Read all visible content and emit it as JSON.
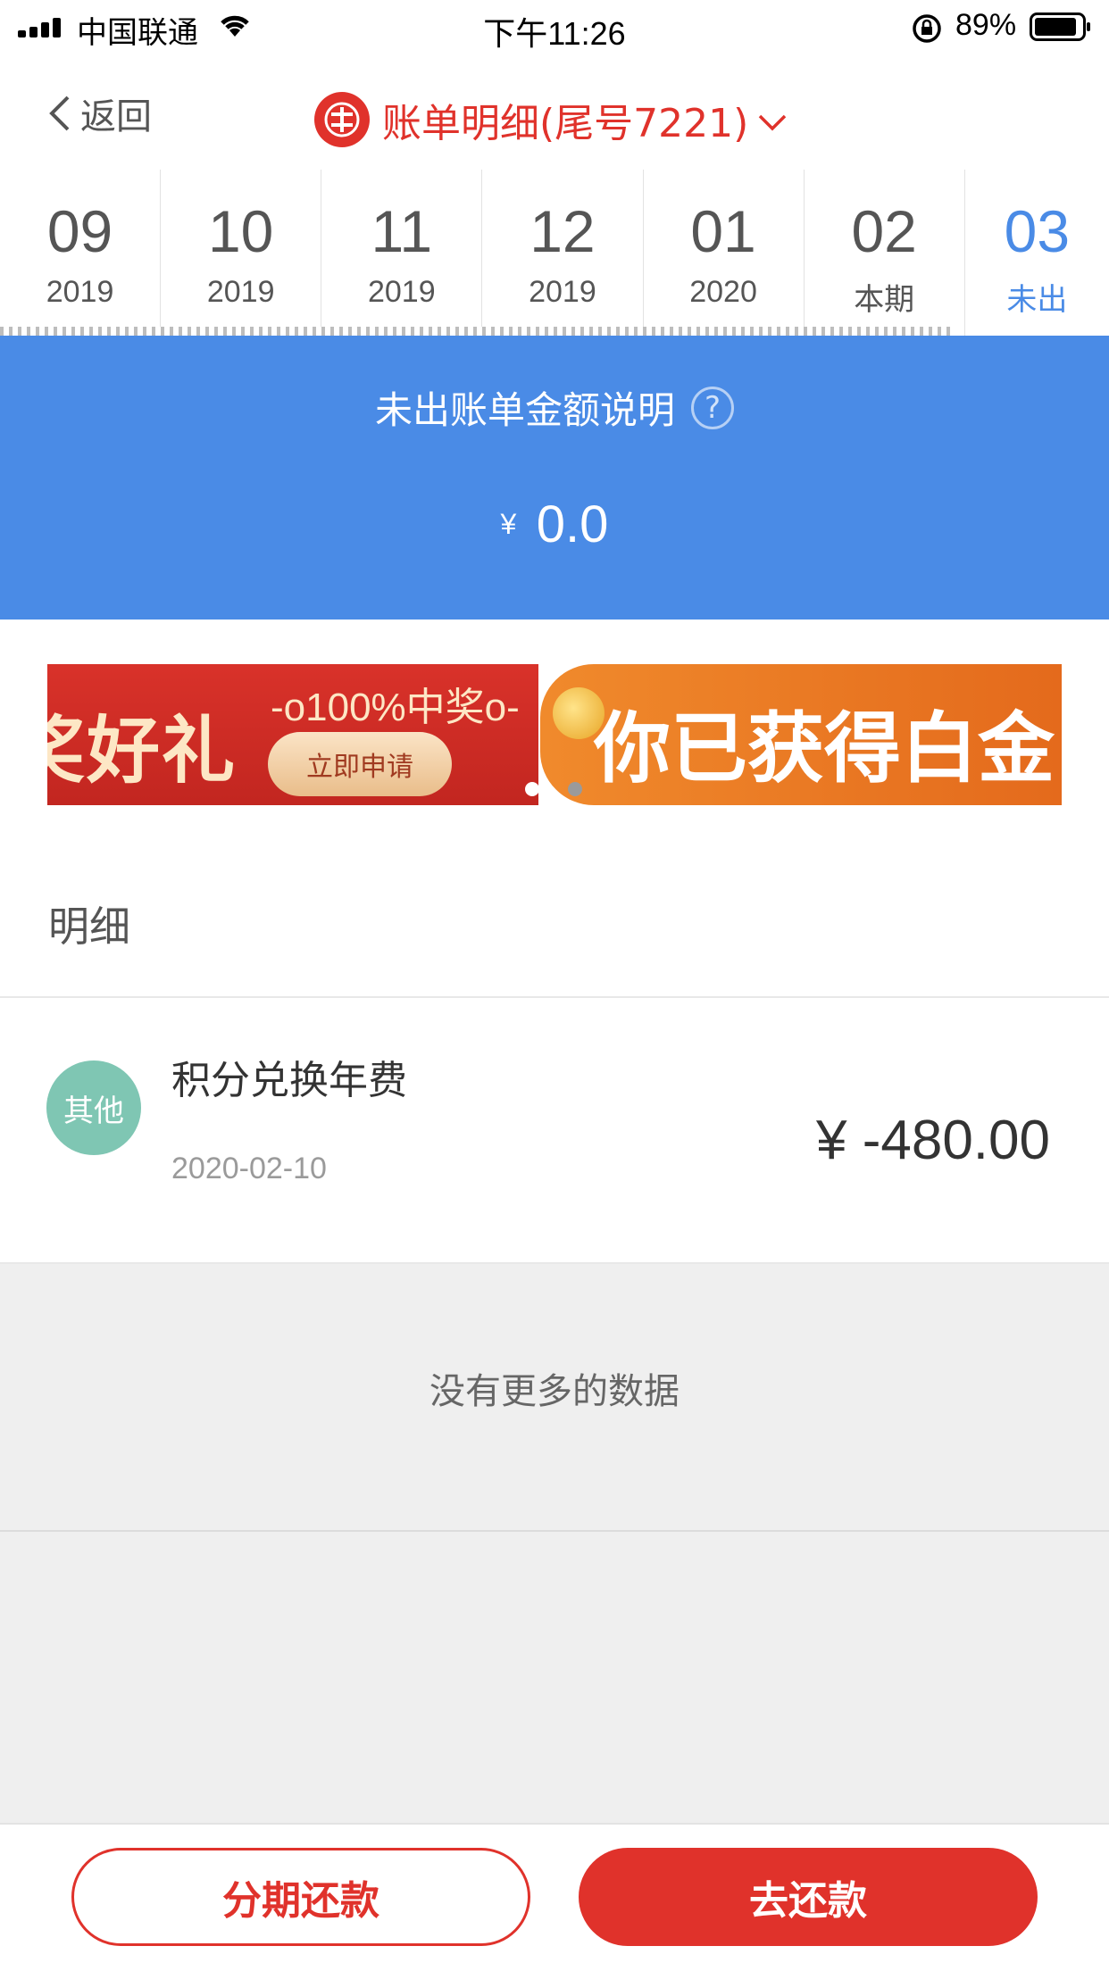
{
  "status_bar": {
    "carrier": "中国联通",
    "time": "下午11:26",
    "battery_percent": "89%",
    "icons": [
      "signal-icon",
      "wifi-icon",
      "orientation-lock-icon",
      "battery-icon"
    ]
  },
  "nav": {
    "back_label": "返回",
    "title": "账单明细(尾号7221)",
    "icons": [
      "chevron-left-icon",
      "bank-logo-icon",
      "chevron-down-icon"
    ]
  },
  "months": [
    {
      "month": "09",
      "sub": "2019"
    },
    {
      "month": "10",
      "sub": "2019"
    },
    {
      "month": "11",
      "sub": "2019"
    },
    {
      "month": "12",
      "sub": "2019"
    },
    {
      "month": "01",
      "sub": "2020"
    },
    {
      "month": "02",
      "sub": "本期"
    },
    {
      "month": "03",
      "sub": "未出"
    }
  ],
  "active_month_index": 6,
  "summary": {
    "label": "未出账单金额说明",
    "help_glyph": "?",
    "currency": "¥",
    "amount": "0.0"
  },
  "banners": {
    "red": {
      "big_text": "奖好礼",
      "prize_text": "-o100%中奖o-",
      "button_label": "立即申请"
    },
    "orange": {
      "headline": "你已获得白金"
    },
    "page_count": 2,
    "active_index": 0
  },
  "details": {
    "section_title": "明细",
    "transactions": [
      {
        "category": "其他",
        "description": "积分兑换年费",
        "date": "2020-02-10",
        "amount": "¥ -480.00"
      }
    ],
    "no_more": "没有更多的数据"
  },
  "actions": {
    "installment_label": "分期还款",
    "repay_label": "去还款"
  },
  "colors": {
    "brand_red": "#e0322b",
    "accent_blue": "#4a8be6",
    "category_teal": "#7fc6b3",
    "background_gray": "#efefef"
  }
}
